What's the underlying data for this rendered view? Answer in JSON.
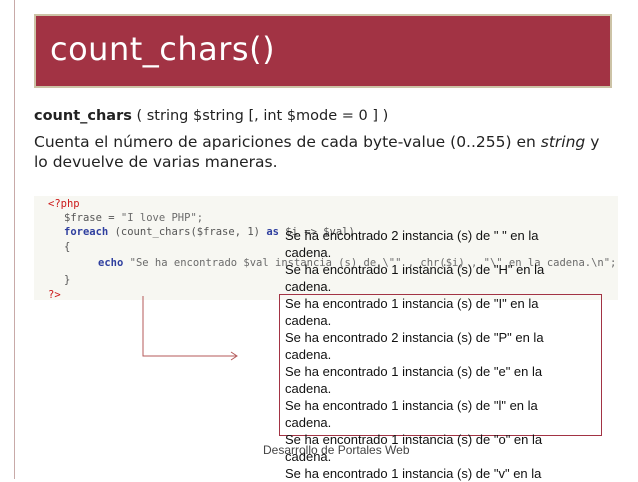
{
  "slide": {
    "title": "count_chars()",
    "signature": {
      "function_name": "count_chars",
      "params": " ( string $string [, int $mode = 0 ] )"
    },
    "description": {
      "part1": "Cuenta el número de apariciones de cada byte-value (0..255) en ",
      "italic": "string",
      "part2": " y lo devuelve de varias maneras."
    },
    "code": {
      "line1": "<?php",
      "line2a": "$frase = ",
      "line2b": "\"I love PHP\";",
      "line3a": "foreach",
      "line3b": " (count_chars($frase, 1) ",
      "line3c": "as",
      "line3d": " $i => $val)",
      "line4": "{",
      "line5a": "echo",
      "line5b": " \"Se ha encontrado $val instancia (s) de \\\"\" , chr($i) , \"\\\" en la cadena.\\n\";",
      "line6": "}",
      "line7": "?>"
    },
    "output_lines": [
      "Se ha encontrado 2 instancia (s) de \" \" en la",
      "cadena.",
      "Se ha encontrado 1 instancia (s) de \"H\" en la",
      "cadena.",
      "Se ha encontrado 1 instancia (s) de \"I\" en la",
      "cadena.",
      "Se ha encontrado 2 instancia (s) de \"P\" en la",
      "cadena.",
      "Se ha encontrado 1 instancia (s) de \"e\" en la",
      "cadena.",
      "Se ha encontrado 1 instancia (s) de \"l\" en la",
      "cadena.",
      "Se ha encontrado 1 instancia (s) de \"o\" en la",
      "cadena.",
      "Se ha encontrado 1 instancia (s) de \"v\" en la"
    ],
    "footer": "Desarrollo de Portales Web",
    "colors": {
      "title_bg": "#a23344",
      "title_border": "#ccc3a6",
      "accent": "#a23344"
    }
  }
}
